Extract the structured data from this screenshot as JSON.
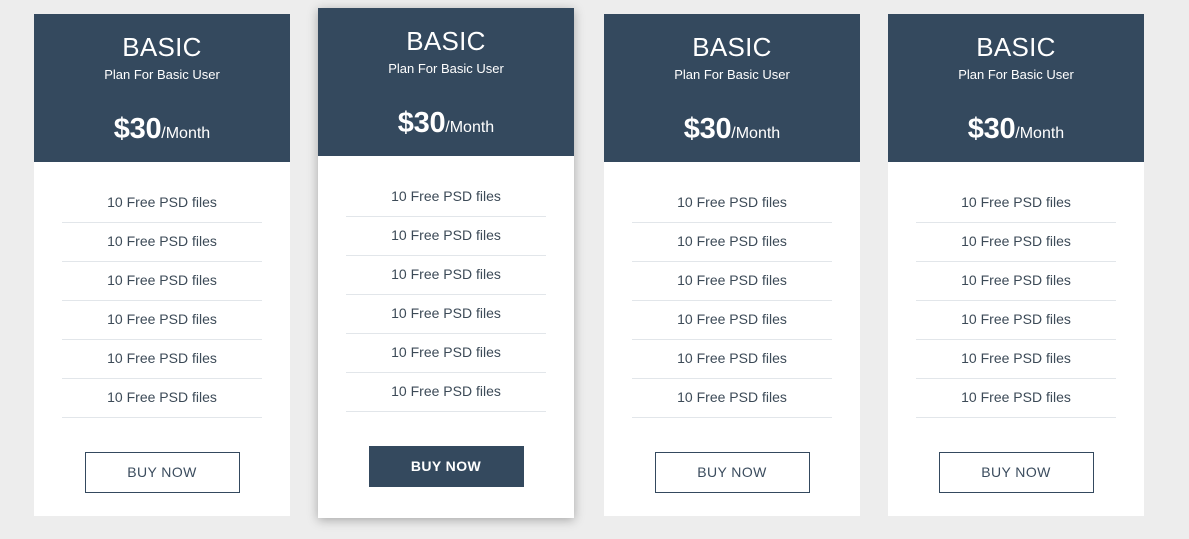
{
  "page": {
    "background_color": "#ededed",
    "accent_color": "#34495e",
    "divider_color": "#4f7399",
    "feature_divider_color": "#e2e6ea"
  },
  "cards": [
    {
      "plan_name": "BASIC",
      "tagline": "Plan For Basic User",
      "price_amount": "$30",
      "price_period": "/Month",
      "features": [
        "10 Free PSD files",
        "10 Free PSD files",
        "10 Free PSD files",
        "10 Free PSD files",
        "10 Free PSD files",
        "10 Free PSD files"
      ],
      "button_label": "BUY NOW",
      "featured": false
    },
    {
      "plan_name": "BASIC",
      "tagline": "Plan For Basic User",
      "price_amount": "$30",
      "price_period": "/Month",
      "features": [
        "10 Free PSD files",
        "10 Free PSD files",
        "10 Free PSD files",
        "10 Free PSD files",
        "10 Free PSD files",
        "10 Free PSD files"
      ],
      "button_label": "BUY NOW",
      "featured": true
    },
    {
      "plan_name": "BASIC",
      "tagline": "Plan For Basic User",
      "price_amount": "$30",
      "price_period": "/Month",
      "features": [
        "10 Free PSD files",
        "10 Free PSD files",
        "10 Free PSD files",
        "10 Free PSD files",
        "10 Free PSD files",
        "10 Free PSD files"
      ],
      "button_label": "BUY NOW",
      "featured": false
    },
    {
      "plan_name": "BASIC",
      "tagline": "Plan For Basic User",
      "price_amount": "$30",
      "price_period": "/Month",
      "features": [
        "10 Free PSD files",
        "10 Free PSD files",
        "10 Free PSD files",
        "10 Free PSD files",
        "10 Free PSD files",
        "10 Free PSD files"
      ],
      "button_label": "BUY NOW",
      "featured": false
    }
  ]
}
